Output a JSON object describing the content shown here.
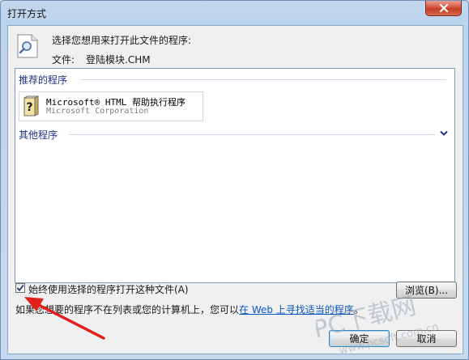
{
  "window": {
    "title": "打开方式"
  },
  "header": {
    "prompt": "选择您想用来打开此文件的程序:",
    "file_label": "文件:",
    "file_name": "登陆模块.CHM"
  },
  "groups": {
    "recommended": "推荐的程序",
    "other": "其他程序"
  },
  "programs": [
    {
      "name": "Microsoft® HTML 帮助执行程序",
      "company": "Microsoft Corporation",
      "icon": "chm-help-icon"
    }
  ],
  "always_use": {
    "label": "始终使用选择的程序打开这种文件(A)",
    "checked": true
  },
  "info": {
    "text_before": "如果您想要的程序不在列表或您的计算机上，您可以",
    "link": "在 Web 上寻找适当的程序",
    "text_after": "。"
  },
  "buttons": {
    "browse": "浏览(B)...",
    "ok": "确定",
    "cancel": "取消"
  },
  "watermark": {
    "text": "PC下载网",
    "url": "www.pcsoft.com.cn"
  },
  "colors": {
    "group_header": "#1e3287",
    "link": "#0b57c0",
    "annotation_arrow": "#e0211d"
  }
}
